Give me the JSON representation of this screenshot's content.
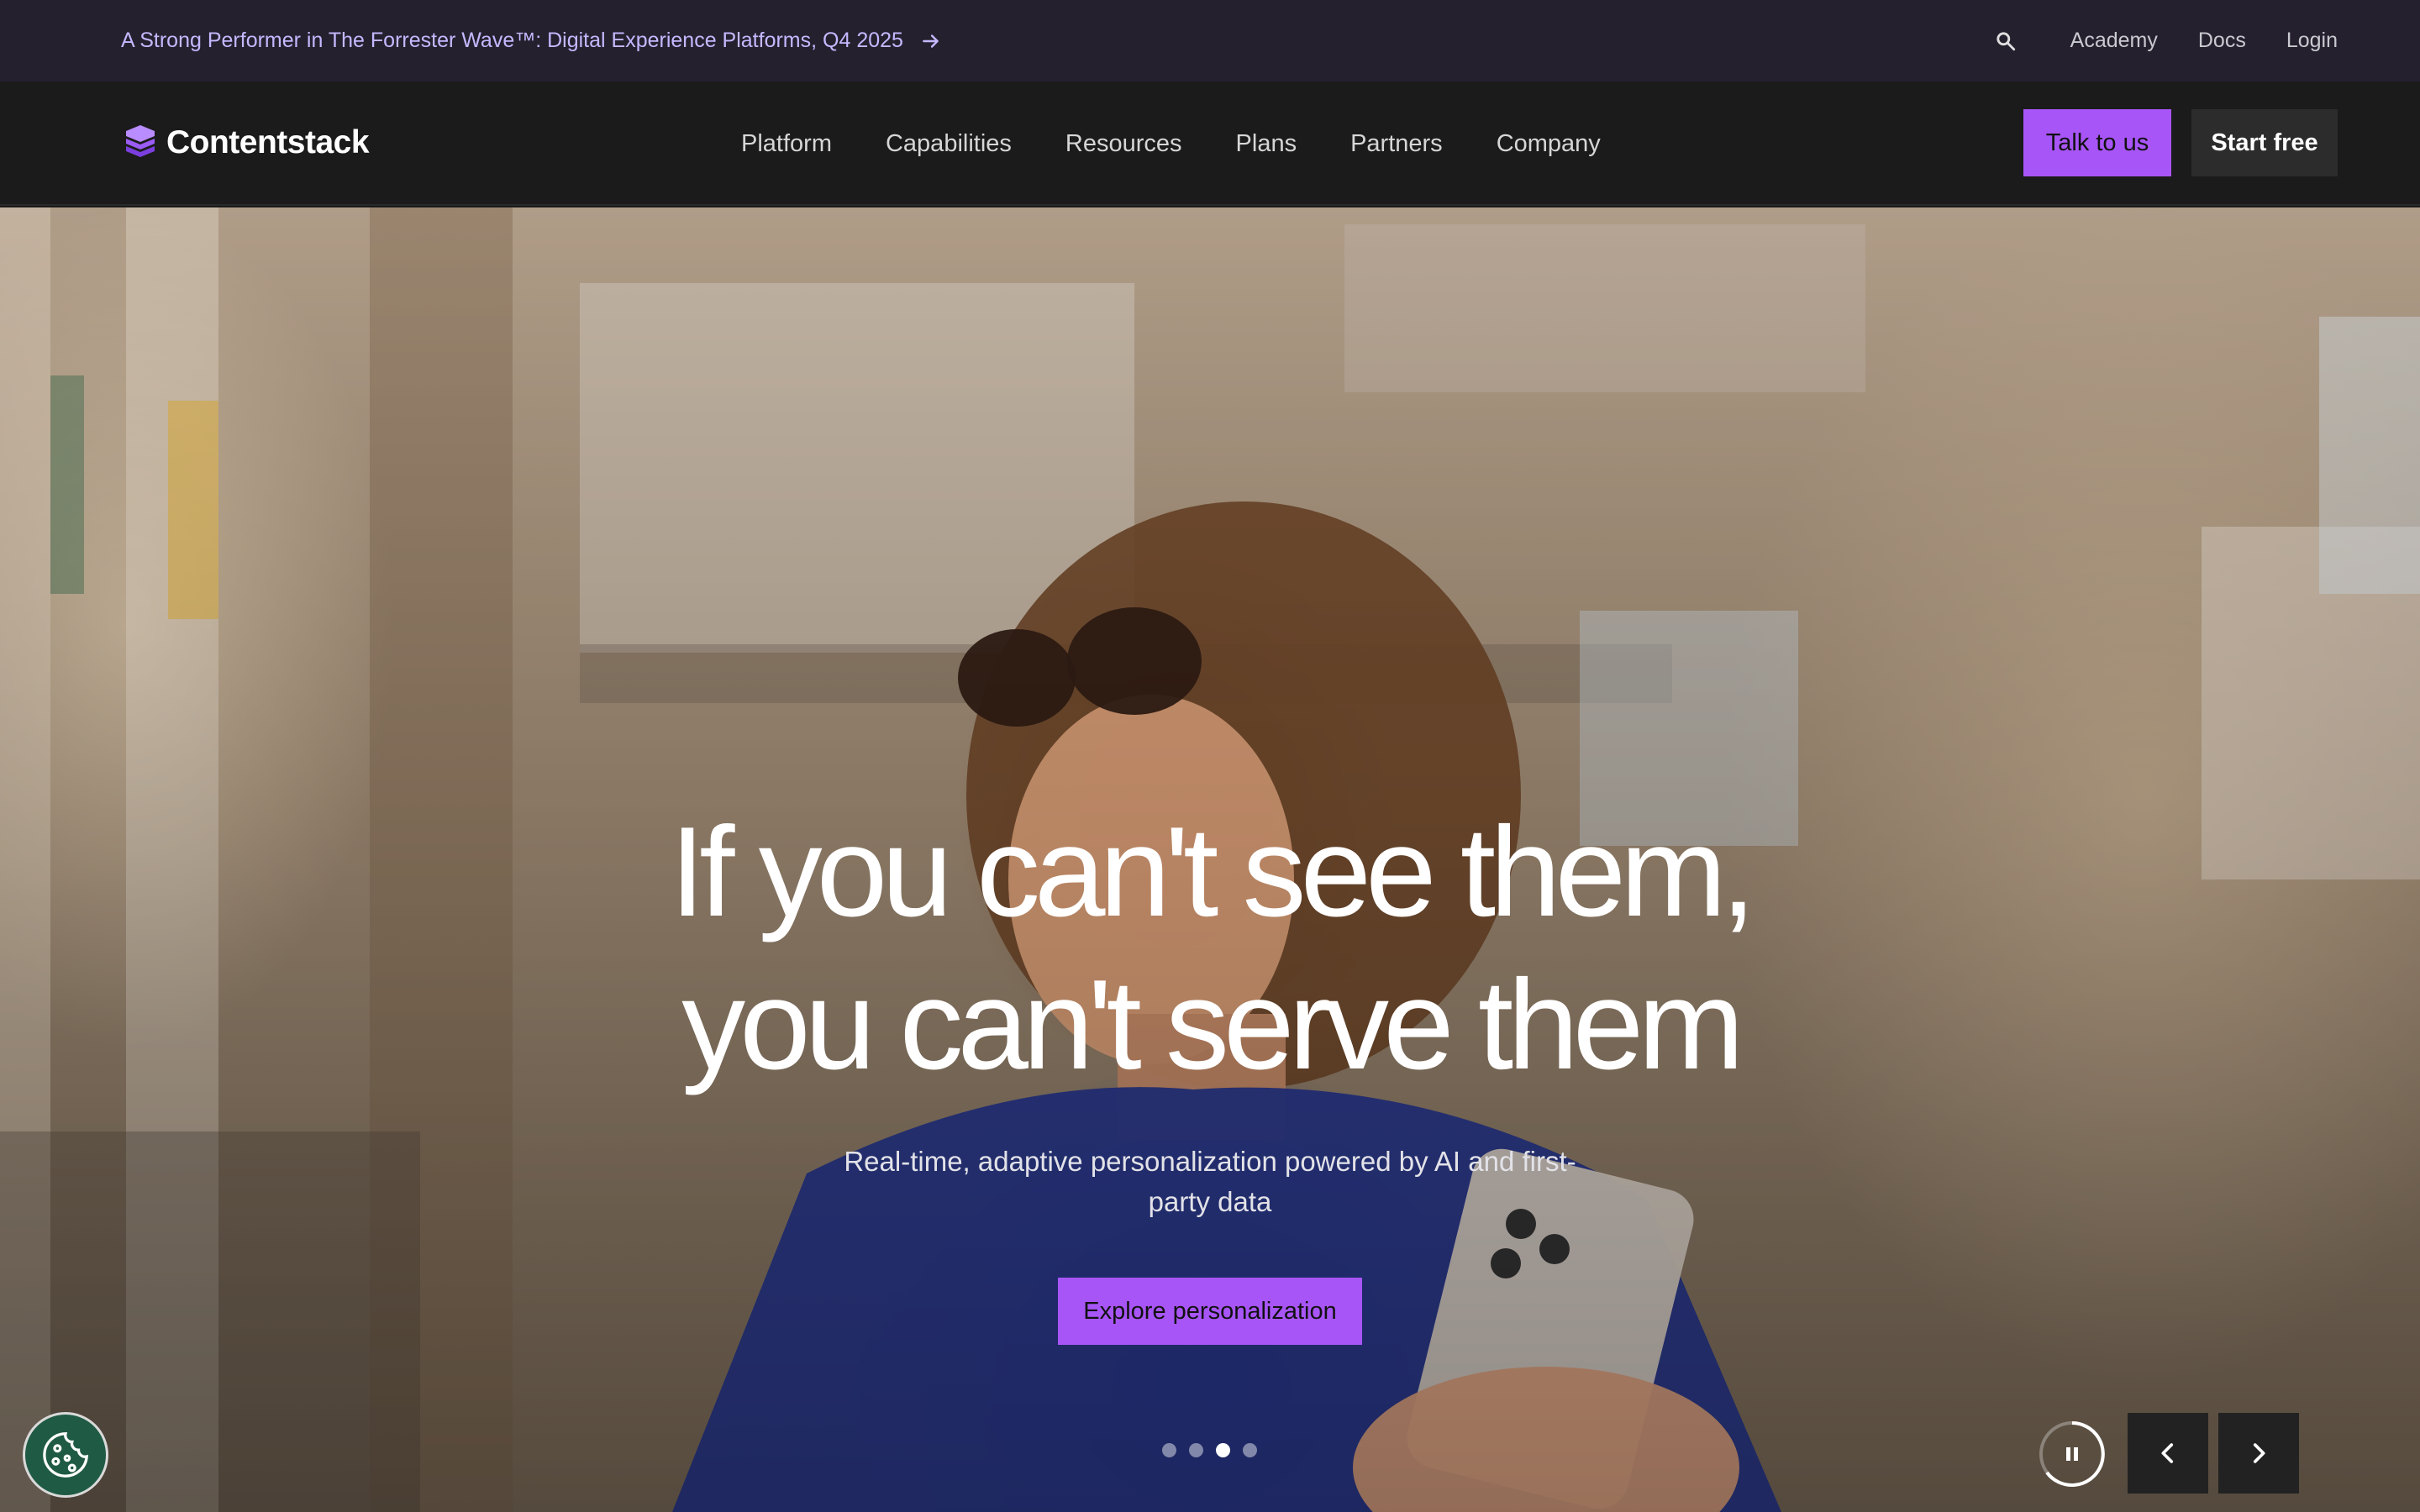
{
  "announcement": {
    "text": "A Strong Performer in The Forrester Wave™: Digital Experience Platforms, Q4 2025",
    "arrow_icon": "arrow-right-icon"
  },
  "utility_nav": {
    "search_icon": "search-icon",
    "items": [
      "Academy",
      "Docs",
      "Login"
    ]
  },
  "brand": {
    "name": "Contentstack",
    "accent": "#a855f7"
  },
  "main_nav": {
    "items": [
      "Platform",
      "Capabilities",
      "Resources",
      "Plans",
      "Partners",
      "Company"
    ]
  },
  "actions": {
    "talk_label": "Talk to us",
    "free_label": "Start free"
  },
  "hero": {
    "title_line1": "If you can't see them,",
    "title_line2": "you can't serve them",
    "subtitle": "Real-time, adaptive personalization powered by AI and first-party data",
    "cta_label": "Explore personalization",
    "slides": {
      "count": 4,
      "active_index": 2
    }
  },
  "controls": {
    "pause_icon": "pause-icon",
    "prev_icon": "chevron-left-icon",
    "next_icon": "chevron-right-icon",
    "cookie_icon": "cookie-icon"
  }
}
